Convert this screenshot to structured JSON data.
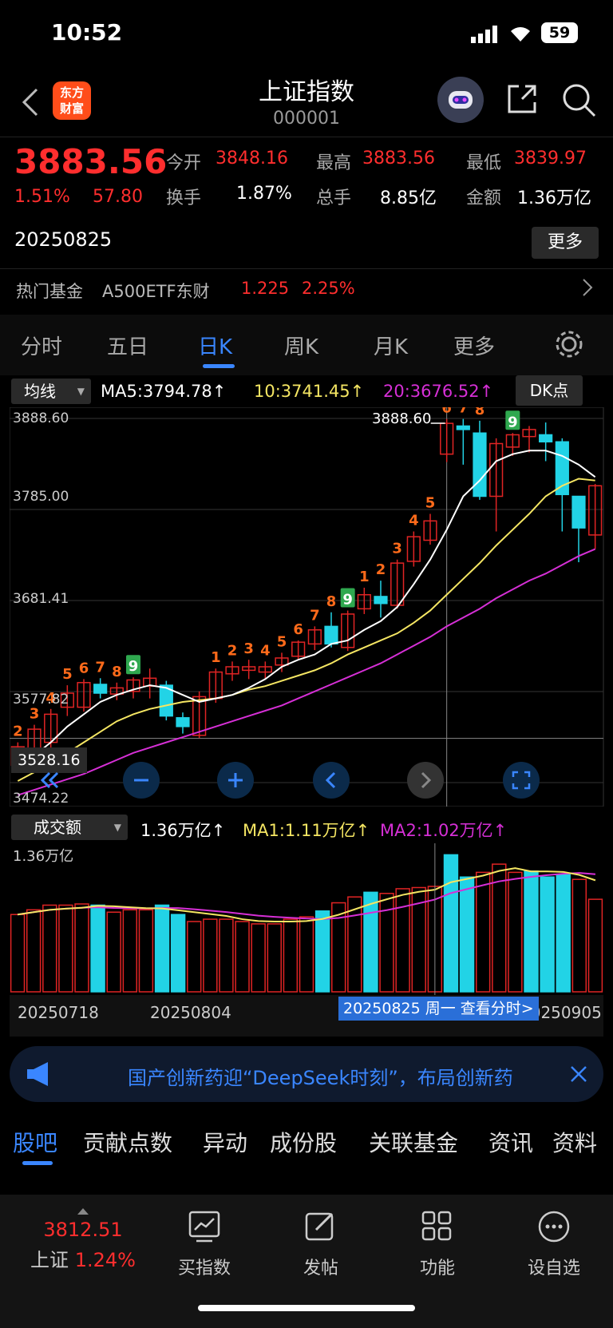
{
  "status": {
    "time": "10:52",
    "battery": "59"
  },
  "nav": {
    "logo_line1": "东方",
    "logo_line2": "财富",
    "title": "上证指数",
    "code": "000001"
  },
  "quote": {
    "price": "3883.56",
    "change_pct": "1.51%",
    "change_abs": "57.80",
    "date": "20250825",
    "open_label": "今开",
    "open": "3848.16",
    "high_label": "最高",
    "high": "3883.56",
    "low_label": "最低",
    "low": "3839.97",
    "turnover_label": "换手",
    "turnover": "1.87%",
    "volume_label": "总手",
    "volume": "8.85亿",
    "amount_label": "金额",
    "amount": "1.36万亿",
    "more": "更多",
    "fund_label": "热门基金",
    "fund_name": "A500ETF东财",
    "fund_price": "1.225",
    "fund_pct": "2.25%"
  },
  "tabs": [
    "分时",
    "五日",
    "日K",
    "周K",
    "月K",
    "更多"
  ],
  "chart": {
    "ma_selector": "均线",
    "ma5": "MA5:3794.78↑",
    "ma10": "10:3741.45↑",
    "ma20": "20:3676.52↑",
    "dk": "DK点",
    "price_ticks": [
      "3888.60",
      "3785.00",
      "3681.41",
      "3577.82",
      "3474.22"
    ],
    "high_marker": "3888.60",
    "low_marker": "3528.16",
    "vol_selector": "成交额",
    "vol_value": "1.36万亿↑",
    "vol_ma1": "MA1:1.11万亿↑",
    "vol_ma2": "MA2:1.02万亿↑",
    "vol_axis": "1.36万亿",
    "date_left": "20250718",
    "date_mid": "20250804",
    "date_right": "20250905",
    "tooltip": "20250825 周一 查看分时>",
    "colors": {
      "up": "#e02424",
      "down": "#22d3e6",
      "ma5": "#ffffff",
      "ma10": "#f5e663",
      "ma20": "#d62fd6"
    }
  },
  "chart_data": {
    "type": "candlestick",
    "ylim": [
      3474.22,
      3888.6
    ],
    "candles": [
      {
        "o": 3494,
        "h": 3520,
        "l": 3490,
        "c": 3515,
        "td": "2"
      },
      {
        "o": 3510,
        "h": 3540,
        "l": 3505,
        "c": 3535,
        "td": "3"
      },
      {
        "o": 3520,
        "h": 3558,
        "l": 3510,
        "c": 3552,
        "td": "4"
      },
      {
        "o": 3560,
        "h": 3585,
        "l": 3550,
        "c": 3576,
        "td": "5"
      },
      {
        "o": 3560,
        "h": 3592,
        "l": 3555,
        "c": 3588,
        "td": "6"
      },
      {
        "o": 3586,
        "h": 3593,
        "l": 3570,
        "c": 3576,
        "td": "7"
      },
      {
        "o": 3575,
        "h": 3588,
        "l": 3568,
        "c": 3582,
        "td": "8"
      },
      {
        "o": 3578,
        "h": 3594,
        "l": 3570,
        "c": 3591,
        "td": "9"
      },
      {
        "o": 3584,
        "h": 3604,
        "l": 3570,
        "c": 3593,
        "td": ""
      },
      {
        "o": 3585,
        "h": 3590,
        "l": 3545,
        "c": 3550,
        "td": ""
      },
      {
        "o": 3548,
        "h": 3554,
        "l": 3530,
        "c": 3538,
        "td": ""
      },
      {
        "o": 3528,
        "h": 3578,
        "l": 3525,
        "c": 3572,
        "td": ""
      },
      {
        "o": 3570,
        "h": 3604,
        "l": 3565,
        "c": 3600,
        "td": "1"
      },
      {
        "o": 3598,
        "h": 3612,
        "l": 3590,
        "c": 3606,
        "td": "2"
      },
      {
        "o": 3602,
        "h": 3614,
        "l": 3592,
        "c": 3606,
        "td": "3"
      },
      {
        "o": 3600,
        "h": 3612,
        "l": 3592,
        "c": 3606,
        "td": "4"
      },
      {
        "o": 3608,
        "h": 3622,
        "l": 3600,
        "c": 3616,
        "td": "5"
      },
      {
        "o": 3618,
        "h": 3636,
        "l": 3614,
        "c": 3634,
        "td": "6"
      },
      {
        "o": 3632,
        "h": 3652,
        "l": 3625,
        "c": 3648,
        "td": "7"
      },
      {
        "o": 3652,
        "h": 3668,
        "l": 3628,
        "c": 3632,
        "td": "8"
      },
      {
        "o": 3628,
        "h": 3670,
        "l": 3624,
        "c": 3666,
        "td": "9"
      },
      {
        "o": 3672,
        "h": 3696,
        "l": 3666,
        "c": 3688,
        "td": "1"
      },
      {
        "o": 3686,
        "h": 3704,
        "l": 3662,
        "c": 3678,
        "td": "2"
      },
      {
        "o": 3676,
        "h": 3728,
        "l": 3672,
        "c": 3724,
        "td": "3"
      },
      {
        "o": 3726,
        "h": 3760,
        "l": 3720,
        "c": 3754,
        "td": "4"
      },
      {
        "o": 3750,
        "h": 3780,
        "l": 3745,
        "c": 3772,
        "td": "5"
      },
      {
        "o": 3848,
        "h": 3888,
        "l": 3839,
        "c": 3883,
        "td": "6"
      },
      {
        "o": 3880,
        "h": 3888,
        "l": 3836,
        "c": 3876,
        "td": "7"
      },
      {
        "o": 3872,
        "h": 3886,
        "l": 3796,
        "c": 3800,
        "td": "8"
      },
      {
        "o": 3800,
        "h": 3866,
        "l": 3760,
        "c": 3860,
        "td": ""
      },
      {
        "o": 3856,
        "h": 3872,
        "l": 3846,
        "c": 3870,
        "td": "9"
      },
      {
        "o": 3868,
        "h": 3880,
        "l": 3850,
        "c": 3876,
        "td": ""
      },
      {
        "o": 3870,
        "h": 3884,
        "l": 3840,
        "c": 3862,
        "td": ""
      },
      {
        "o": 3862,
        "h": 3866,
        "l": 3760,
        "c": 3802,
        "td": ""
      },
      {
        "o": 3800,
        "h": 3800,
        "l": 3725,
        "c": 3764,
        "td": ""
      },
      {
        "o": 3756,
        "h": 3814,
        "l": 3740,
        "c": 3812,
        "td": ""
      }
    ],
    "ma5": [
      3492,
      3505,
      3520,
      3538,
      3552,
      3566,
      3574,
      3580,
      3585,
      3582,
      3574,
      3566,
      3570,
      3574,
      3582,
      3592,
      3606,
      3614,
      3620,
      3632,
      3636,
      3648,
      3658,
      3674,
      3700,
      3728,
      3762,
      3800,
      3818,
      3840,
      3848,
      3852,
      3852,
      3846,
      3836,
      3822
    ],
    "ma10": [
      3476,
      3486,
      3496,
      3508,
      3520,
      3532,
      3544,
      3552,
      3558,
      3562,
      3566,
      3568,
      3570,
      3574,
      3580,
      3584,
      3590,
      3596,
      3602,
      3610,
      3620,
      3628,
      3636,
      3644,
      3656,
      3670,
      3688,
      3706,
      3724,
      3744,
      3762,
      3780,
      3800,
      3812,
      3820,
      3818
    ],
    "ma20": [
      3460,
      3466,
      3472,
      3478,
      3484,
      3492,
      3500,
      3508,
      3514,
      3520,
      3526,
      3532,
      3538,
      3544,
      3550,
      3556,
      3562,
      3570,
      3578,
      3586,
      3594,
      3602,
      3610,
      3620,
      3630,
      3640,
      3652,
      3662,
      3672,
      3684,
      3694,
      3704,
      3712,
      3722,
      3732,
      3740
    ],
    "volume": [
      0.66,
      0.7,
      0.74,
      0.74,
      0.75,
      0.74,
      0.68,
      0.7,
      0.7,
      0.74,
      0.66,
      0.6,
      0.62,
      0.62,
      0.6,
      0.58,
      0.58,
      0.62,
      0.64,
      0.69,
      0.76,
      0.81,
      0.85,
      0.84,
      0.88,
      0.89,
      0.9,
      1.17,
      0.98,
      1.02,
      1.09,
      1.02,
      1.03,
      0.98,
      1.0,
      0.96,
      0.79
    ]
  },
  "banner": {
    "text": "国产创新药迎“DeepSeek时刻”，布局创新药"
  },
  "bottom_tabs": [
    "股吧",
    "贡献点数",
    "异动",
    "成份股",
    "关联基金",
    "资讯",
    "资料"
  ],
  "bottom_bar": {
    "index_price": "3812.51",
    "index_name": "上证",
    "index_pct": "1.24%",
    "items": [
      "买指数",
      "发帖",
      "功能",
      "设自选"
    ]
  }
}
